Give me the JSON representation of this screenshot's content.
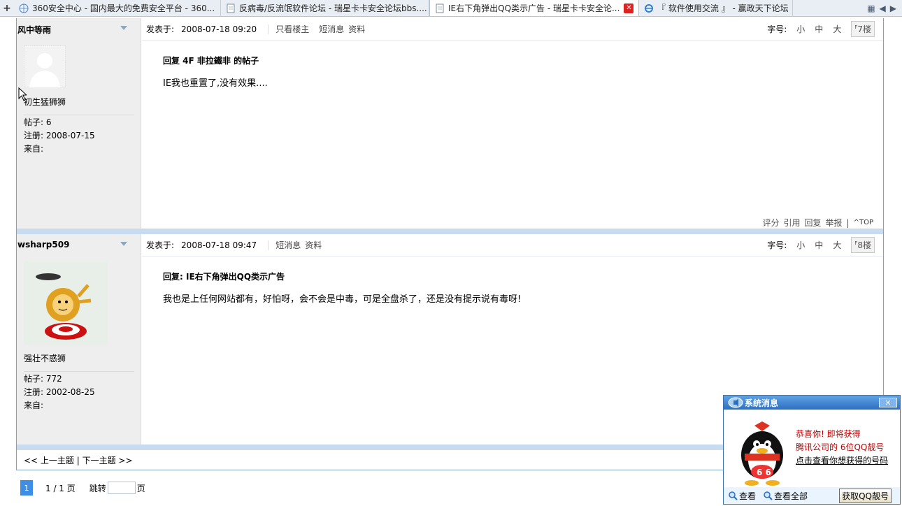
{
  "tabs": [
    {
      "title": "360安全中心 - 国内最大的免费安全平台 - 360...",
      "active": false
    },
    {
      "title": "反病毒/反流氓软件论坛 - 瑞星卡卡安全论坛bbs....",
      "active": false
    },
    {
      "title": "IE右下角弹出QQ类示广告 - 瑞星卡卡安全论...",
      "active": true
    },
    {
      "title": "『 软件使用交流 』 - 赢政天下论坛",
      "active": false
    }
  ],
  "posts": [
    {
      "author": "风中等雨",
      "rank": "初生猛狮狮",
      "posts_label": "帖子: 6",
      "reg_label": "注册: 2008-07-15",
      "from_label": "来自:",
      "posted_label": "发表于:",
      "time": "2008-07-18 09:20",
      "links": [
        "只看楼主",
        "短消息",
        "资料"
      ],
      "fontsize_label": "字号:",
      "sizes": [
        "小",
        "中",
        "大"
      ],
      "floor": "7楼",
      "reply_title": "回复  4F 非拉鐵非  的帖子",
      "body": "IE我也重置了,没有效果....",
      "footer": [
        "评分",
        "引用",
        "回复",
        "举报"
      ],
      "top": "TOP"
    },
    {
      "author": "wsharp509",
      "rank": "强壮不惑狮",
      "posts_label": "帖子: 772",
      "reg_label": "注册: 2002-08-25",
      "from_label": "来自:",
      "posted_label": "发表于:",
      "time": "2008-07-18 09:47",
      "links": [
        "短消息",
        "资料"
      ],
      "fontsize_label": "字号:",
      "sizes": [
        "小",
        "中",
        "大"
      ],
      "floor": "8楼",
      "reply_title": "回复: IE右下角弹出QQ类示广告",
      "body": "我也是上任何网站都有，好怕呀，会不会是中毒，可是全盘杀了，还是没有提示说有毒呀!"
    }
  ],
  "nav": {
    "prev": "<< 上一主题",
    "sep": " | ",
    "next": "下一主题 >>"
  },
  "pager": {
    "current": "1",
    "pages": "1 / 1 页",
    "jump": "跳转",
    "unit": "页"
  },
  "qq_popup": {
    "title": "系统消息",
    "line1": "恭喜你! 即将获得",
    "line2": "腾讯公司的    6位QQ靓号",
    "link": "点击查看你想获得的号码",
    "view": "查看",
    "view_all": "查看全部",
    "get_button": "获取QQ靓号"
  },
  "colors": {
    "accent": "#3f8ee6",
    "divider": "#c9dbee",
    "sidebar": "#eeeeee",
    "popup_title": "#2e6fc0",
    "popup_red": "#c00000"
  }
}
